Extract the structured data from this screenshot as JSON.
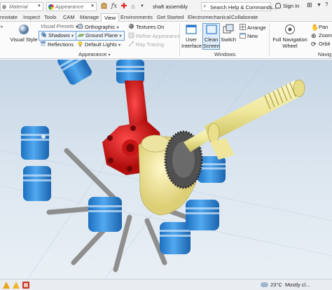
{
  "quick_access": {
    "material": "Material",
    "appearance": "Appearance",
    "fx": "fx"
  },
  "document": {
    "title": "shaft assembly"
  },
  "search": {
    "text": "Search Help & Commands..."
  },
  "account": {
    "sign_in": "Sign In"
  },
  "tabs": [
    {
      "label": "nnotate"
    },
    {
      "label": "Inspect"
    },
    {
      "label": "Tools"
    },
    {
      "label": "CAM"
    },
    {
      "label": "Manage"
    },
    {
      "label": "View",
      "active": true
    },
    {
      "label": "Environments"
    },
    {
      "label": "Get Started"
    },
    {
      "label": "Electromechanical"
    },
    {
      "label": "Collaborate"
    }
  ],
  "ribbon": {
    "visual_style": "Visual Style",
    "visual_presets": "Visual Presets",
    "shadows": "Shadows",
    "reflections": "Reflections",
    "orthographic": "Orthographic",
    "ground_plane": "Ground Plane",
    "default_lights": "Default Lights",
    "textures_on": "Textures On",
    "refine_appearance": "Refine Appearance",
    "ray_tracing": "Ray Tracing",
    "appearance_panel": "Appearance",
    "user_interface": [
      "User",
      "Interface"
    ],
    "clean_screen": [
      "Clean",
      "Screen"
    ],
    "switch": "Switch",
    "arrange": "Arrange",
    "new": "New",
    "windows_panel": "Windows",
    "full_navigation_wheel": [
      "Full Navigation",
      "Wheel"
    ],
    "pan": "Pan",
    "zoom": "Zoom",
    "orbit": "Orbit",
    "navigate_panel": "Navig"
  },
  "taskbar": {
    "temperature": "23°C",
    "weather": "Mostly cl..."
  },
  "colors": {
    "piston_blue": "#2e8fe0",
    "rod_red": "#e51a1a",
    "shaft_yellow": "#f2eca0",
    "gear_gray": "#4b4b4b",
    "accent": "#2b78c9"
  }
}
